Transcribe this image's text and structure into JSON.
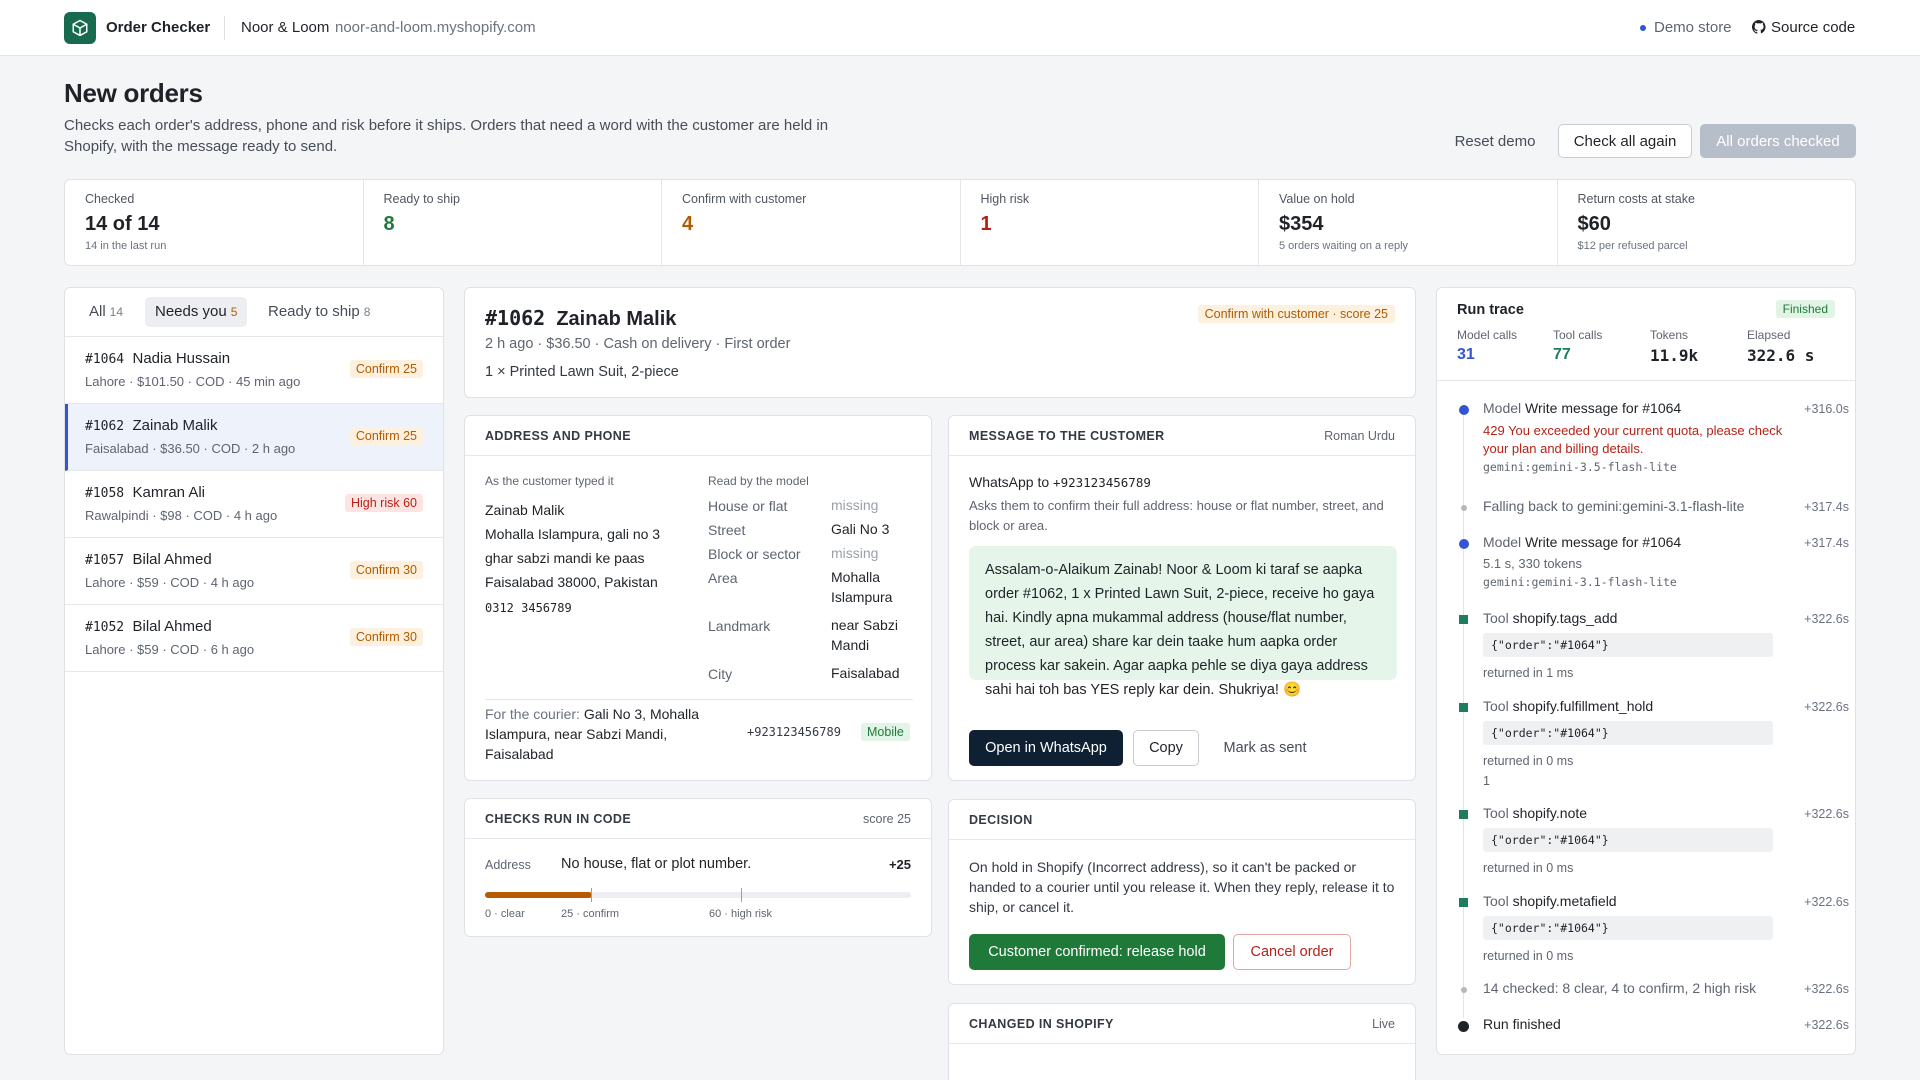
{
  "header": {
    "app_title": "Order Checker",
    "store_name": "Noor & Loom",
    "store_domain": "noor-and-loom.myshopify.com",
    "demo_label": "Demo store",
    "source_label": "Source code"
  },
  "page": {
    "title": "New orders",
    "subtitle": "Checks each order's address, phone and risk before it ships. Orders that need a word with the customer are held in Shopify, with the message ready to send.",
    "reset_label": "Reset demo",
    "check_again_label": "Check all again",
    "all_checked_label": "All orders checked"
  },
  "stats": [
    {
      "label": "Checked",
      "value": "14 of 14",
      "note": "14 in the last run",
      "color": "#1f2328"
    },
    {
      "label": "Ready to ship",
      "value": "8",
      "note": "",
      "color": "#1f7a3a"
    },
    {
      "label": "Confirm with customer",
      "value": "4",
      "note": "",
      "color": "#b05c00"
    },
    {
      "label": "High risk",
      "value": "1",
      "note": "",
      "color": "#b42318"
    },
    {
      "label": "Value on hold",
      "value": "$354",
      "note": "5 orders waiting on a reply",
      "color": "#1f2328"
    },
    {
      "label": "Return costs at stake",
      "value": "$60",
      "note": "$12 per refused parcel",
      "color": "#1f2328"
    }
  ],
  "list": {
    "tabs": [
      {
        "label": "All",
        "count": "14"
      },
      {
        "label": "Needs you",
        "count": "5"
      },
      {
        "label": "Ready to ship",
        "count": "8"
      }
    ],
    "items": [
      {
        "num": "#1064",
        "name": "Nadia Hussain",
        "meta": "Lahore · $101.50 · COD · 45 min ago",
        "badge": "Confirm 25"
      },
      {
        "num": "#1062",
        "name": "Zainab Malik",
        "meta": "Faisalabad · $36.50 · COD · 2 h ago",
        "badge": "Confirm 25"
      },
      {
        "num": "#1058",
        "name": "Kamran Ali",
        "meta": "Rawalpindi · $98 · COD · 4 h ago",
        "badge": "High risk 60"
      },
      {
        "num": "#1057",
        "name": "Bilal Ahmed",
        "meta": "Lahore · $59 · COD · 4 h ago",
        "badge": "Confirm 30"
      },
      {
        "num": "#1052",
        "name": "Bilal Ahmed",
        "meta": "Lahore · $59 · COD · 6 h ago",
        "badge": "Confirm 30"
      }
    ]
  },
  "order": {
    "num": "#1062",
    "name": "Zainab Malik",
    "badge": "Confirm with customer · score 25",
    "meta": "2 h ago · $36.50 · Cash on delivery · First order",
    "items": "1 × Printed Lawn Suit, 2-piece"
  },
  "address": {
    "heading": "ADDRESS AND PHONE",
    "typed_label": "As the customer typed it",
    "model_label": "Read by the model",
    "typed_name": "Zainab Malik",
    "typed_lines": [
      "Mohalla Islampura, gali no 3",
      "ghar sabzi mandi ke paas",
      "Faisalabad 38000, Pakistan"
    ],
    "typed_phone": "0312 3456789",
    "fields": [
      {
        "label": "House or flat",
        "value": "missing"
      },
      {
        "label": "Street",
        "value": "Gali No 3"
      },
      {
        "label": "Block or sector",
        "value": "missing"
      },
      {
        "label": "Area",
        "value": "Mohalla Islampura"
      },
      {
        "label": "Landmark",
        "value": "near Sabzi Mandi"
      },
      {
        "label": "City",
        "value": "Faisalabad"
      }
    ],
    "courier_label": "For the courier:",
    "courier_value": "Gali No 3, Mohalla Islampura, near Sabzi Mandi, Faisalabad",
    "courier_phone": "+923123456789",
    "phone_badge": "Mobile"
  },
  "message": {
    "heading": "MESSAGE TO THE CUSTOMER",
    "language": "Roman Urdu",
    "channel_label": "WhatsApp to",
    "channel_phone": "+923123456789",
    "desc": "Asks them to confirm their full address: house or flat number, street, and block or area.",
    "body": "Assalam-o-Alaikum Zainab! Noor & Loom ki taraf se aapka order #1062, 1 x Printed Lawn Suit, 2-piece, receive ho gaya hai. Kindly apna mukammal address (house/flat number, street, aur area) share kar dein taake hum aapka order process kar sakein. Agar aapka pehle se diya gaya address sahi hai toh bas YES reply kar dein. Shukriya! 😊",
    "open_label": "Open in WhatsApp",
    "copy_label": "Copy",
    "mark_label": "Mark as sent"
  },
  "checks": {
    "heading": "CHECKS RUN IN CODE",
    "score": "score 25",
    "row_label": "Address",
    "row_text": "No house, flat or plot number.",
    "row_points": "+25",
    "score_value": 25,
    "scale_max": 100,
    "ticks": [
      "0 · clear",
      "25 · confirm",
      "60 · high risk"
    ]
  },
  "decision": {
    "heading": "DECISION",
    "text": "On hold in Shopify (Incorrect address), so it can't be packed or handed to a courier until you release it. When they reply, release it to ship, or cancel it.",
    "release_label": "Customer confirmed: release hold",
    "cancel_label": "Cancel order"
  },
  "changed": {
    "heading": "CHANGED IN SHOPIFY",
    "status": "Live"
  },
  "trace": {
    "title": "Run trace",
    "status": "Finished",
    "metrics": [
      {
        "label": "Model calls",
        "value": "31"
      },
      {
        "label": "Tool calls",
        "value": "77"
      },
      {
        "label": "Tokens",
        "value": "11.9k"
      },
      {
        "label": "Elapsed",
        "value": "322.6 s"
      }
    ],
    "events": [
      {
        "kind": "Model",
        "title": "Write message for #1064",
        "time": "+316.0s",
        "error": "429 You exceeded your current quota, please check your plan and billing details.",
        "detail": "gemini:gemini-3.5-flash-lite"
      },
      {
        "kind": "",
        "title": "Falling back to gemini:gemini-3.1-flash-lite",
        "time": "+317.4s"
      },
      {
        "kind": "Model",
        "title": "Write message for #1064",
        "time": "+317.4s",
        "sub": "5.1 s, 330 tokens",
        "detail": "gemini:gemini-3.1-flash-lite"
      },
      {
        "kind": "Tool",
        "title": "shopify.tags_add",
        "time": "+322.6s",
        "code": "{\"order\":\"#1064\"}",
        "result": "returned in 1 ms"
      },
      {
        "kind": "Tool",
        "title": "shopify.fulfillment_hold",
        "time": "+322.6s",
        "code": "{\"order\":\"#1064\"}",
        "result": "returned in 0 ms",
        "extra": "1"
      },
      {
        "kind": "Tool",
        "title": "shopify.note",
        "time": "+322.6s",
        "code": "{\"order\":\"#1064\"}",
        "result": "returned in 0 ms"
      },
      {
        "kind": "Tool",
        "title": "shopify.metafield",
        "time": "+322.6s",
        "code": "{\"order\":\"#1064\"}",
        "result": "returned in 0 ms"
      },
      {
        "kind": "",
        "title": "14 checked: 8 clear, 4 to confirm, 2 high risk",
        "time": "+322.6s"
      },
      {
        "kind": "",
        "title": "Run finished",
        "time": "+322.6s"
      }
    ]
  },
  "colors": {
    "brand": "#176a4d",
    "model_dot": "#3454d1",
    "tool_dot": "#1d7d5c",
    "whatsapp_btn": "#0f2033",
    "release_btn": "#1f7a3a"
  }
}
